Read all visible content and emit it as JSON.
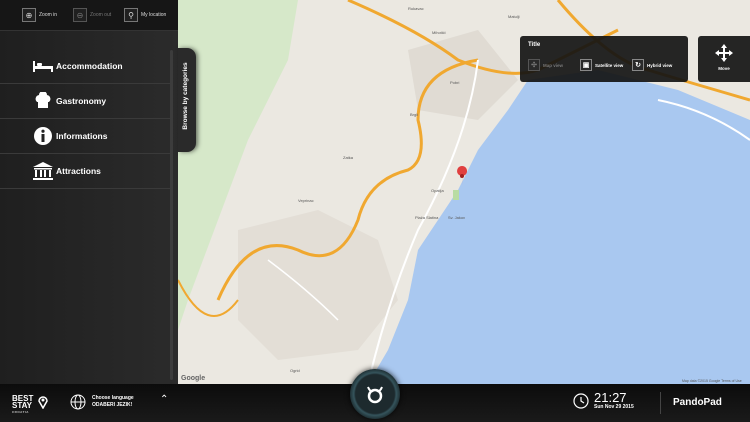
{
  "toolbar": {
    "zoom_in": "Zoom in",
    "zoom_out": "Zoom out",
    "my_location": "My location"
  },
  "sidebar": {
    "categories": [
      {
        "label": "Accommodation",
        "icon": "bed-icon"
      },
      {
        "label": "Gastronomy",
        "icon": "chef-hat-icon"
      },
      {
        "label": "Informations",
        "icon": "info-icon"
      },
      {
        "label": "Attractions",
        "icon": "museum-icon"
      }
    ],
    "browse_tab": "Browse by categories"
  },
  "title_panel": {
    "title": "Title",
    "views": [
      {
        "label": "Map view",
        "enabled": false
      },
      {
        "label": "Satellite view",
        "enabled": true
      },
      {
        "label": "Hybrid view",
        "enabled": true
      }
    ]
  },
  "move_panel": {
    "label": "Move"
  },
  "map": {
    "labels": {
      "rukavac": "Rukavac",
      "mihotici": "Mihotići",
      "matulji": "Matulji",
      "pobri": "Pobri",
      "brgii": "Brgii",
      "zatka": "Zatka",
      "veprinac": "Veprinac",
      "opatija": "Opatija",
      "plaza": "Plaža Slatina",
      "sv_jakov": "Sv. Jakov",
      "ogrid": "Ogrid"
    },
    "google": "Google",
    "attribution": "Map data ©2015 Google  Terms of Use"
  },
  "bottombar": {
    "logo_line1": "BEST",
    "logo_line2": "STAY",
    "logo_sub": "CROATIA",
    "lang_line1": "Choose language",
    "lang_line2": "ODABERI JEZIK!",
    "time": "21:27",
    "date": "Sun Nov 29 2015",
    "brand": "PandoPad"
  },
  "colors": {
    "water": "#a9c8f0",
    "land": "#ebe8e1",
    "road": "#f0a830",
    "accent": "#e04040"
  }
}
